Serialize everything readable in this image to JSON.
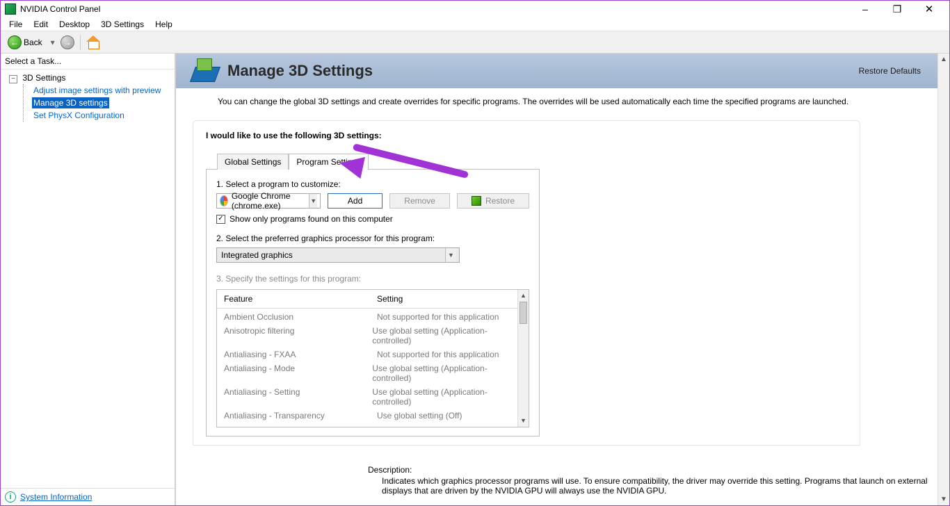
{
  "window": {
    "title": "NVIDIA Control Panel"
  },
  "menu": {
    "file": "File",
    "edit": "Edit",
    "desktop": "Desktop",
    "threeD": "3D Settings",
    "help": "Help"
  },
  "toolbar": {
    "back": "Back"
  },
  "sidebar": {
    "heading": "Select a Task...",
    "root": "3D Settings",
    "items": [
      "Adjust image settings with preview",
      "Manage 3D settings",
      "Set PhysX Configuration"
    ],
    "sysinfo": "System Information"
  },
  "header": {
    "title": "Manage 3D Settings",
    "restore": "Restore Defaults"
  },
  "intro": "You can change the global 3D settings and create overrides for specific programs. The overrides will be used automatically each time the specified programs are launched.",
  "panel": {
    "lead": "I would like to use the following 3D settings:",
    "tabs": {
      "global": "Global Settings",
      "program": "Program Settings"
    },
    "step1": "1. Select a program to customize:",
    "program_selected": "Google Chrome (chrome.exe)",
    "add": "Add",
    "remove": "Remove",
    "restore": "Restore",
    "show_only": "Show only programs found on this computer",
    "step2": "2. Select the preferred graphics processor for this program:",
    "gpu_selected": "Integrated graphics",
    "step3": "3. Specify the settings for this program:",
    "col_feature": "Feature",
    "col_setting": "Setting",
    "rows": [
      {
        "f": "Ambient Occlusion",
        "s": "Not supported for this application"
      },
      {
        "f": "Anisotropic filtering",
        "s": "Use global setting (Application-controlled)"
      },
      {
        "f": "Antialiasing - FXAA",
        "s": "Not supported for this application"
      },
      {
        "f": "Antialiasing - Mode",
        "s": "Use global setting (Application-controlled)"
      },
      {
        "f": "Antialiasing - Setting",
        "s": "Use global setting (Application-controlled)"
      },
      {
        "f": "Antialiasing - Transparency",
        "s": "Use global setting (Off)"
      }
    ]
  },
  "description": {
    "title": "Description:",
    "text": "Indicates which graphics processor programs will use. To ensure compatibility, the driver may override this setting. Programs that launch on external displays that are driven by the NVIDIA GPU will always use the NVIDIA GPU."
  }
}
